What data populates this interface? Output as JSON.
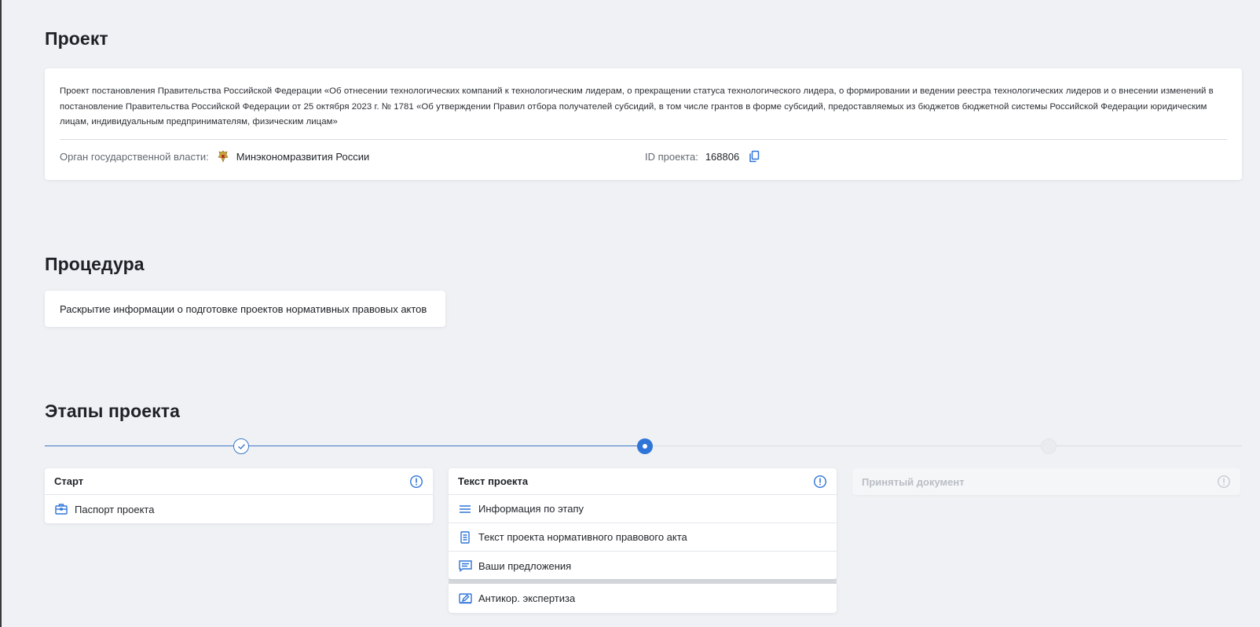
{
  "project": {
    "heading": "Проект",
    "description": "Проект постановления Правительства Российской Федерации «Об отнесении технологических компаний к технологическим лидерам, о прекращении статуса технологического лидера, о формировании и ведении реестра технологических лидеров и о внесении изменений в постановление Правительства Российской Федерации от 25 октября 2023 г. № 1781 «Об утверждении Правил отбора получателей субсидий, в том числе грантов в форме субсидий, предоставляемых из бюджетов бюджетной системы Российской Федерации юридическим лицам, индивидуальным предпринимателям, физическим лицам»",
    "authority_label": "Орган государственной власти:",
    "authority_value": "Минэкономразвития России",
    "authority_icon": "coat-of-arms-icon",
    "id_label": "ID проекта:",
    "id_value": "168806",
    "copy_icon": "copy-icon"
  },
  "procedure": {
    "heading": "Процедура",
    "value": "Раскрытие информации о подготовке проектов нормативных правовых актов"
  },
  "stages": {
    "heading": "Этапы проекта",
    "steps": [
      {
        "status": "completed"
      },
      {
        "status": "current"
      },
      {
        "status": "upcoming"
      }
    ],
    "cards": [
      {
        "title": "Старт",
        "items": [
          {
            "label": "Паспорт проекта",
            "icon": "briefcase-icon"
          }
        ]
      },
      {
        "title": "Текст проекта",
        "items": [
          {
            "label": "Информация по этапу",
            "icon": "list-icon"
          },
          {
            "label": "Текст проекта нормативного правового акта",
            "icon": "document-icon"
          },
          {
            "label": "Ваши предложения",
            "icon": "comment-icon"
          },
          {
            "label": "Антикор. экспертиза",
            "icon": "edit-box-icon"
          }
        ]
      },
      {
        "title": "Принятый документ",
        "items": []
      }
    ]
  },
  "colors": {
    "accent": "#2f75d8",
    "line_done": "#3d79c6",
    "background": "#eff1f4",
    "muted_text": "#b9bec5"
  }
}
